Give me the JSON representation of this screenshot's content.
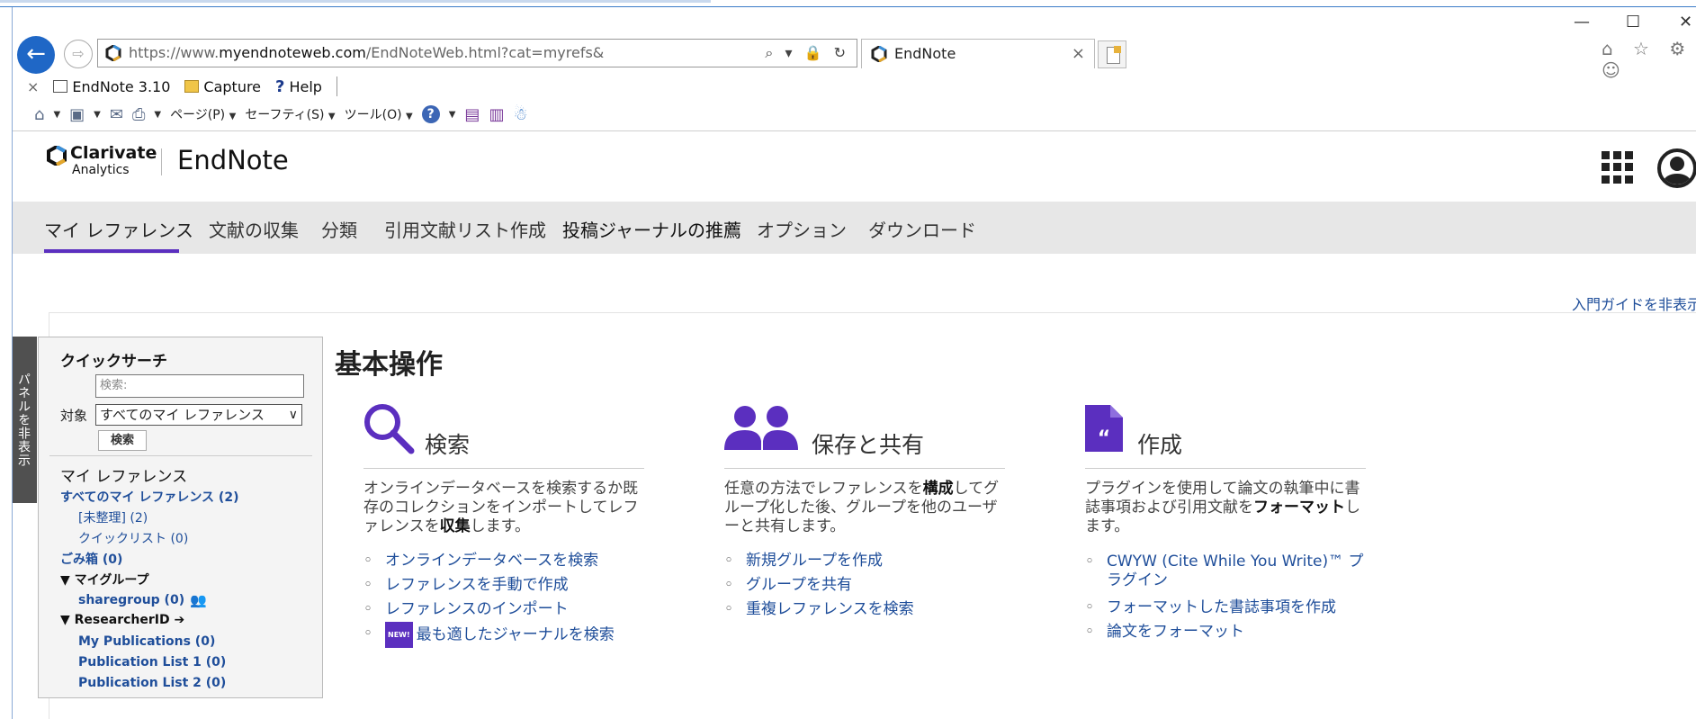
{
  "browser": {
    "url_prefix": "https://www.",
    "url_domain": "myendnoteweb.com",
    "url_path": "/EndNoteWeb.html?cat=myrefs&",
    "tab_title": "EndNote",
    "tab_close": "×",
    "win_minimize": "—",
    "win_maximize": "☐",
    "win_close": "✕",
    "address_actions": "⌕ ▾ 🔒 ↻",
    "right_icons": "⌂ ☆ ⚙ ☺",
    "favorites": {
      "close": "×",
      "items": [
        {
          "label": "EndNote 3.10"
        },
        {
          "label": "Capture"
        },
        {
          "label": "Help"
        }
      ]
    },
    "commandbar": {
      "page": "ページ(P)",
      "safety": "セーフティ(S)",
      "tools": "ツール(O)",
      "help": "?"
    }
  },
  "header": {
    "brand_name": "Clarivate",
    "brand_sub": "Analytics",
    "product": "EndNote"
  },
  "nav": {
    "tabs": [
      {
        "label": "マイ レファレンス"
      },
      {
        "label": "文献の収集"
      },
      {
        "label": "分類"
      },
      {
        "label": "引用文献リスト作成"
      },
      {
        "label": "投稿ジャーナルの推薦"
      },
      {
        "label": "オプション"
      },
      {
        "label": "ダウンロード"
      }
    ]
  },
  "hide_guide": "入門ガイドを非表示",
  "panel": {
    "toggle_label": "パネルを非表示",
    "quicksearch_title": "クイックサーチ",
    "search_placeholder": "検索:",
    "scope_label": "対象",
    "scope_value": "すべてのマイ レファレンス",
    "search_button": "検索",
    "myrefs_title": "マイ レファレンス",
    "all_refs": "すべてのマイ レファレンス (2)",
    "unfiled": "[未整理] (2)",
    "quicklist": "クイックリスト (0)",
    "trash": "ごみ箱 (0)",
    "mygroups": "▼ マイグループ",
    "sharegroup": "sharegroup (0)",
    "researcherid": "▼ ResearcherID ➔",
    "my_publications": "My Publications (0)",
    "publication_list_1": "Publication List 1 (0)",
    "publication_list_2": "Publication List 2 (0)"
  },
  "main": {
    "title": "基本操作",
    "columns": [
      {
        "icon": "search-icon",
        "title": "検索",
        "desc_1": "オンラインデータベースを検索するか既存のコレクションをインポートしてレファレンスを",
        "desc_bold": "収集",
        "desc_2": "します。",
        "links": [
          "オンラインデータベースを検索",
          "レファレンスを手動で作成",
          "レファレンスのインポート",
          "最も適したジャーナルを検索"
        ],
        "new_badge": "NEW!"
      },
      {
        "icon": "people-icon",
        "title": "保存と共有",
        "desc_1": "任意の方法でレファレンスを",
        "desc_bold": "構成",
        "desc_2": "してグループ化した後、グループを他のユーザーと共有します。",
        "links": [
          "新規グループを作成",
          "グループを共有",
          "重複レファレンスを検索"
        ]
      },
      {
        "icon": "document-quote-icon",
        "title": "作成",
        "desc_1": "プラグインを使用して論文の執筆中に書誌事項および引用文献を",
        "desc_bold": "フォーマット",
        "desc_2": "します。",
        "links": [
          "CWYW (Cite While You Write)™ プラグイン",
          "フォーマットした書誌事項を作成",
          "論文をフォーマット"
        ]
      }
    ]
  },
  "colors": {
    "accent": "#5b2fbf",
    "link": "#1f4e9a",
    "nav_bg": "#e7e7e7"
  }
}
